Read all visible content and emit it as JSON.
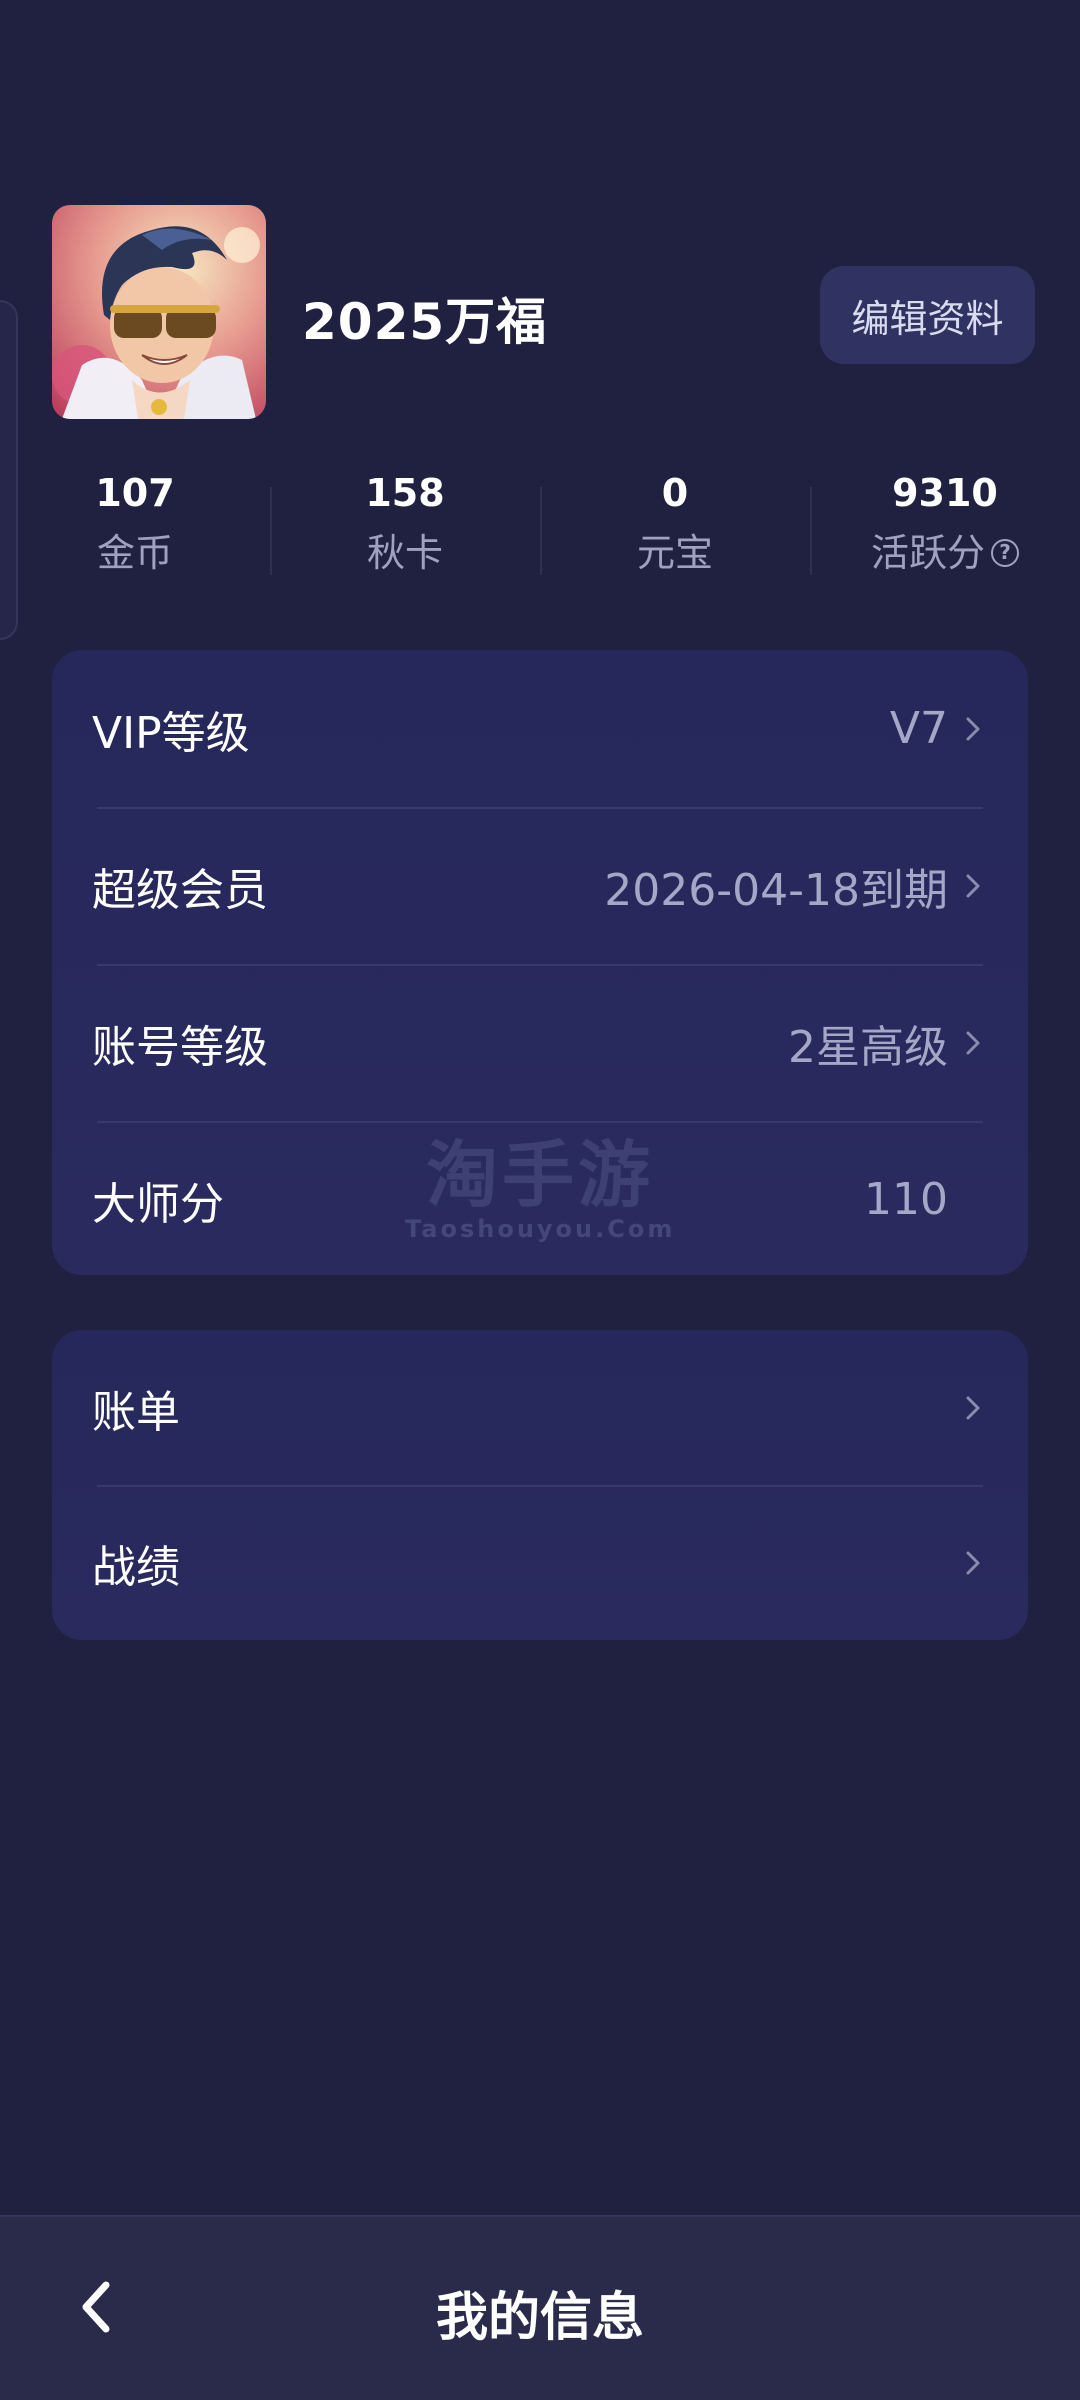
{
  "profile": {
    "username": "2025万福",
    "edit_label": "编辑资料"
  },
  "stats": [
    {
      "value": "107",
      "label": "金币"
    },
    {
      "value": "158",
      "label": "秋卡"
    },
    {
      "value": "0",
      "label": "元宝"
    },
    {
      "value": "9310",
      "label": "活跃分",
      "help": "?"
    }
  ],
  "card1": {
    "rows": [
      {
        "label": "VIP等级",
        "value": "V7"
      },
      {
        "label": "超级会员",
        "value": "2026-04-18到期"
      },
      {
        "label": "账号等级",
        "value": "2星高级"
      },
      {
        "label": "大师分",
        "value": "110"
      }
    ]
  },
  "card2": {
    "rows": [
      {
        "label": "账单"
      },
      {
        "label": "战绩"
      }
    ]
  },
  "watermark": {
    "cn": "淘手游",
    "en": "Taoshouyou.Com"
  },
  "bottom_bar": {
    "title": "我的信息"
  },
  "colors": {
    "background": "#202140",
    "card": "#28295c",
    "secondary_text": "#a5a7c6"
  }
}
